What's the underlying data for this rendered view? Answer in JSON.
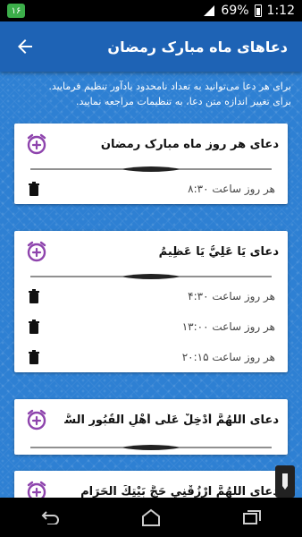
{
  "status_bar": {
    "notification": "۱۶",
    "battery": "69%",
    "time": "1:12"
  },
  "app_bar": {
    "title": "دعاهای ماه مبارک رمضان",
    "back_icon": "arrow-back-icon"
  },
  "hint_lines": [
    "برای هر دعا می‌توانید به تعداد نامحدود یادآور تنظیم فرمایید.",
    "برای تغییر اندازه متن دعا، به تنظیمات مراجعه نمایید."
  ],
  "cards": [
    {
      "title": "دعای هر روز ماه مبارک رمضان",
      "reminders": [
        "هر روز ساعت ۸:۳۰"
      ]
    },
    {
      "title": "دعای يَا عَلِيُّ يَا عَظِيمُ",
      "reminders": [
        "هر روز ساعت ۴:۳۰",
        "هر روز ساعت ۱۳:۰۰",
        "هر روز ساعت ۲۰:۱۵"
      ]
    },
    {
      "title": "دعای اللَّهُمَّ أَدْخِلْ عَلَى أَهْلِ الْقُبُورِ السُّرُور",
      "reminders": []
    },
    {
      "title": "دعای اللَّهُمَّ ارْزُقْنِي حَجَّ بَيْتِكَ الْحَرَام",
      "reminders": []
    }
  ],
  "colors": {
    "app_bar": "#1e63b5",
    "background": "#2e80d3",
    "alarm_icon": "#8e44ad"
  },
  "nav": {
    "back_icon": "nav-back-icon",
    "home_icon": "nav-home-icon",
    "recents_icon": "nav-recents-icon"
  }
}
